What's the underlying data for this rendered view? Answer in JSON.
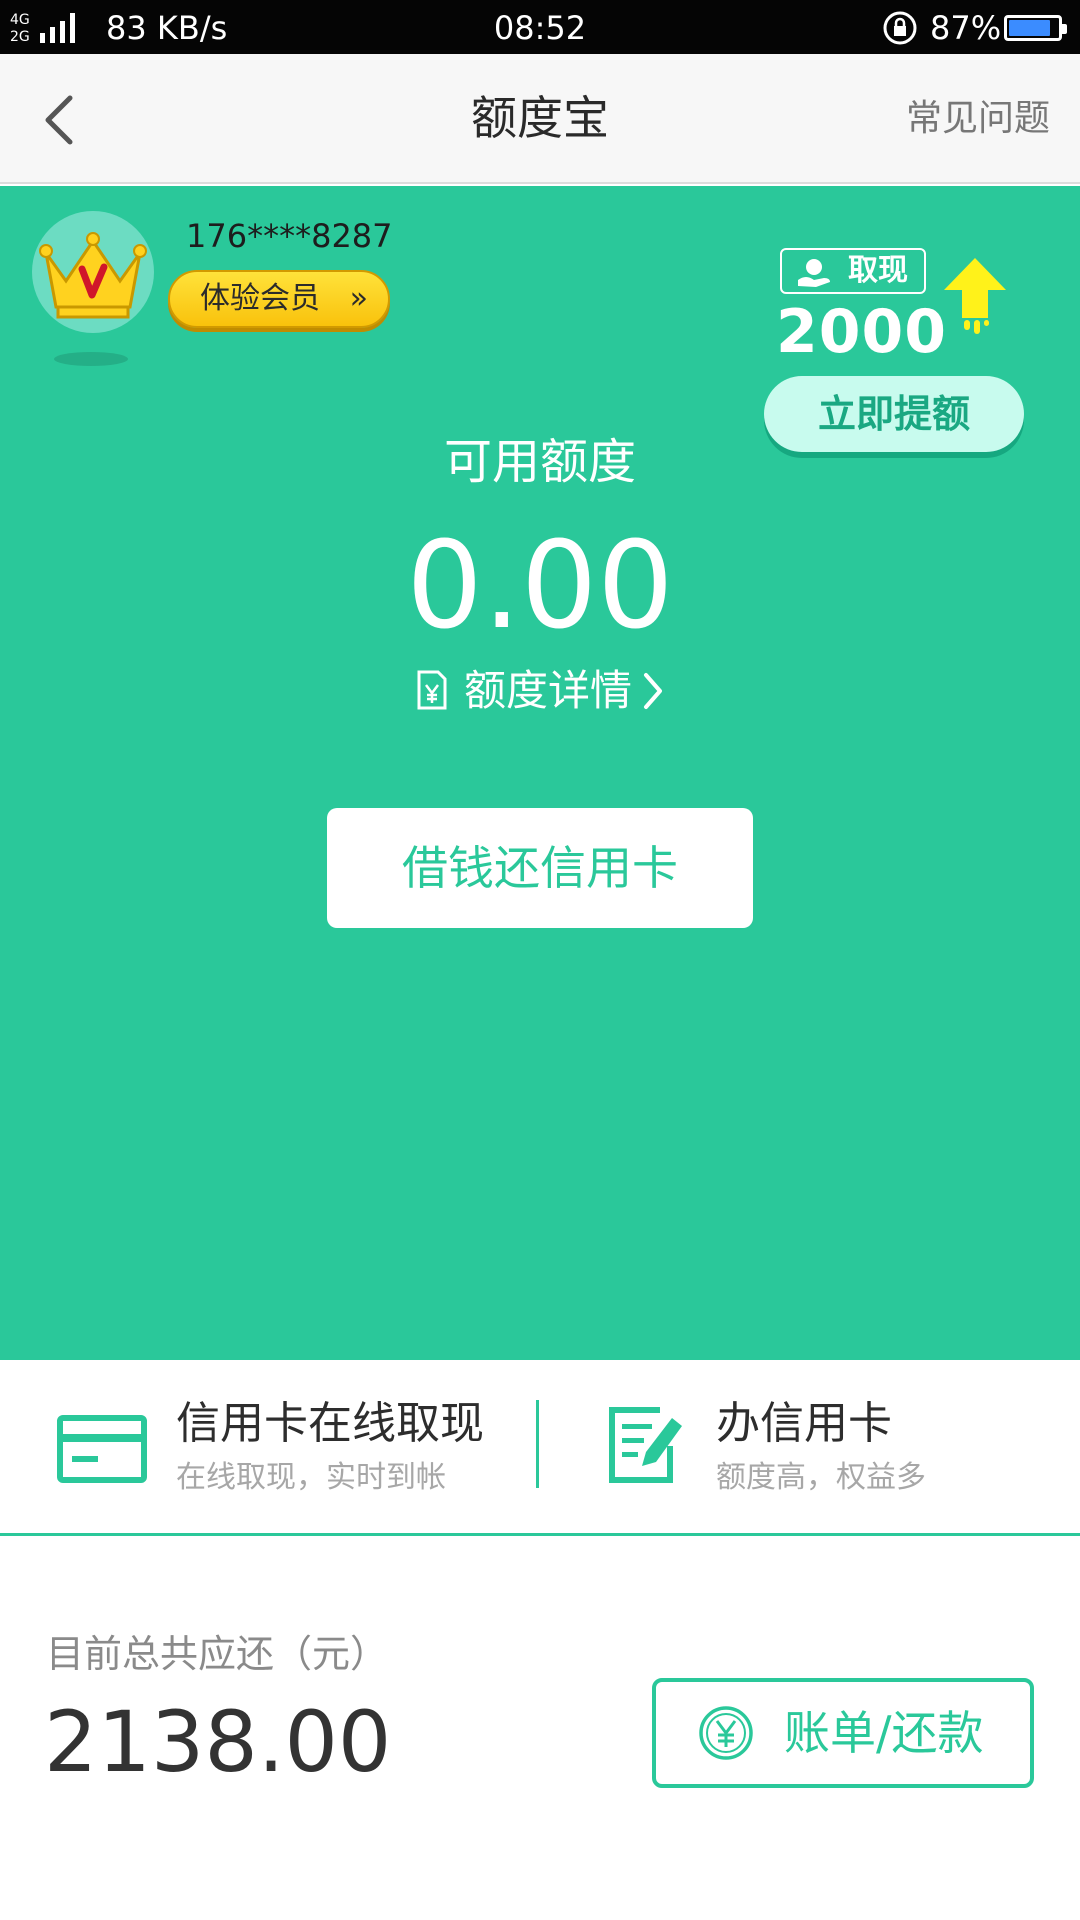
{
  "status_bar": {
    "network": "4G 2G",
    "speed": "83 KB/s",
    "time": "08:52",
    "battery_percent": "87%",
    "battery_level": 0.87,
    "battery_color": "#3b8cff"
  },
  "nav": {
    "back_icon": "chevron-left-icon",
    "title": "额度宝",
    "faq_label": "常见问题"
  },
  "profile": {
    "avatar_icon": "vip-crown-icon",
    "phone": "176****8287",
    "member_label": "体验会员",
    "member_chevron": "»"
  },
  "promo": {
    "tag_label": "取现",
    "amount": "2000",
    "raise_label": "立即提额"
  },
  "quota": {
    "label": "可用额度",
    "value": "0.00",
    "detail_label": "额度详情"
  },
  "loan_button_label": "借钱还信用卡",
  "features": [
    {
      "title": "信用卡在线取现",
      "subtitle": "在线取现，实时到帐",
      "icon": "credit-card-icon"
    },
    {
      "title": "办信用卡",
      "subtitle": "额度高，权益多",
      "icon": "edit-form-icon"
    }
  ],
  "summary": {
    "label": "目前总共应还（元）",
    "value": "2138.00",
    "bill_button_label": "账单/还款",
    "bill_icon": "yen-circle-icon"
  },
  "colors": {
    "brand_green": "#2ac89a",
    "gold": "#f9c20c",
    "text_dark": "#2d2d2d",
    "text_muted": "#a7a7a7"
  }
}
